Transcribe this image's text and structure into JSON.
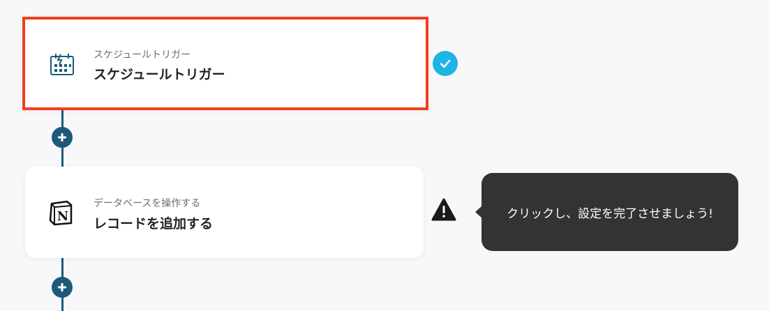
{
  "trigger_step": {
    "subtitle": "スケジュールトリガー",
    "title": "スケジュールトリガー",
    "icon": "schedule-calendar-icon",
    "status": "complete"
  },
  "action_step": {
    "subtitle": "データベースを操作する",
    "title": "レコードを追加する",
    "icon": "notion-icon",
    "status": "warning"
  },
  "tooltip": {
    "text": "クリックし、設定を完了させましょう!"
  },
  "colors": {
    "selected_border": "#f0401c",
    "connector": "#1c5a7a",
    "check": "#1fb3e6",
    "tooltip_bg": "#333335"
  }
}
